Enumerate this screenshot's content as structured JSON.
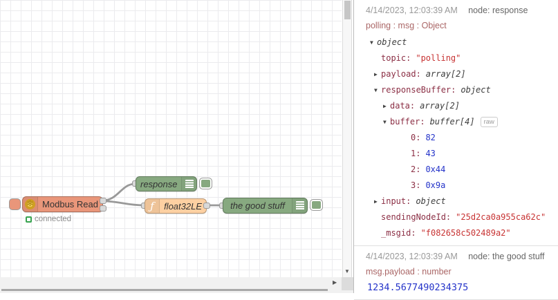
{
  "canvas": {
    "nodes": {
      "modbus": {
        "label": "Modbus Read",
        "color": "#e9967a",
        "status": "connected"
      },
      "response": {
        "label": "response",
        "color": "#87a980"
      },
      "func": {
        "label": "float32LE",
        "color": "#fdd0a2",
        "icon_glyph": "ƒ"
      },
      "goodstuff": {
        "label": "the good stuff",
        "color": "#87a980"
      }
    },
    "modbus_icon_glyph": "✻",
    "wire_color": "#999999"
  },
  "icons": {
    "scroll_down": "▼",
    "scroll_right": "▶"
  },
  "debug": {
    "messages": [
      {
        "timestamp": "4/14/2023, 12:03:39 AM",
        "node": "node: response",
        "topic": "polling : msg : Object",
        "tree": [
          {
            "caret": "▼",
            "key": "",
            "value": "object"
          },
          {
            "caret": "",
            "key": "topic:",
            "value": "\"polling\""
          },
          {
            "caret": "▶",
            "key": "payload:",
            "value": "array[2]"
          },
          {
            "caret": "▼",
            "key": "responseBuffer:",
            "value": "object"
          },
          {
            "caret": "▶",
            "key": "data:",
            "value": "array[2]"
          },
          {
            "caret": "▼",
            "key": "buffer:",
            "value": "buffer[4]",
            "badge": "raw"
          },
          {
            "caret": "",
            "key": "0:",
            "value": "82"
          },
          {
            "caret": "",
            "key": "1:",
            "value": "43"
          },
          {
            "caret": "",
            "key": "2:",
            "value": "0x44"
          },
          {
            "caret": "",
            "key": "3:",
            "value": "0x9a"
          },
          {
            "caret": "▶",
            "key": "input:",
            "value": "object"
          },
          {
            "caret": "",
            "key": "sendingNodeId:",
            "value": "\"25d2ca0a955ca62c\""
          },
          {
            "caret": "",
            "key": "_msgid:",
            "value": "\"f082658c502489a2\""
          }
        ]
      },
      {
        "timestamp": "4/14/2023, 12:03:39 AM",
        "node": "node: the good stuff",
        "topic": "msg.payload : number",
        "payload": "1234.5677490234375"
      }
    ],
    "value_colors": {
      "key": "#8b2e44",
      "string": "#c73232",
      "number": "#2433c9"
    }
  }
}
